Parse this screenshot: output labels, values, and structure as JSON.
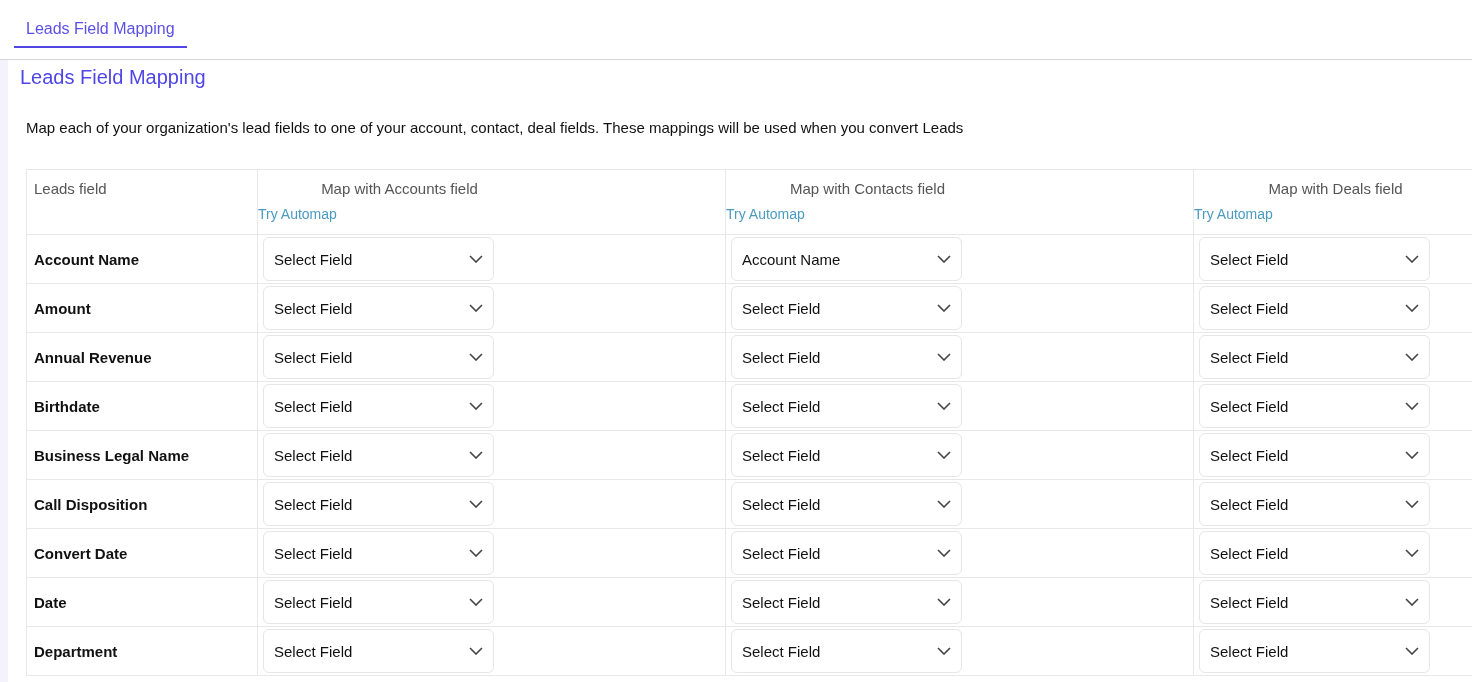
{
  "tabs": [
    {
      "label": "Leads Field Mapping",
      "selected": true
    }
  ],
  "page": {
    "title": "Leads Field Mapping",
    "description": "Map each of your organization's lead fields to one of your account, contact, deal fields. These mappings will be used when you convert Leads"
  },
  "table": {
    "columns": [
      {
        "label": "Leads field"
      },
      {
        "label": "Map with Accounts field",
        "action": "Try Automap"
      },
      {
        "label": "Map with Contacts field",
        "action": "Try Automap"
      },
      {
        "label": "Map with Deals field",
        "action": "Try Automap"
      }
    ],
    "rows": [
      {
        "field": "Account Name",
        "mappings": [
          "Select Field",
          "Account Name",
          "Select Field"
        ]
      },
      {
        "field": "Amount",
        "mappings": [
          "Select Field",
          "Select Field",
          "Select Field"
        ]
      },
      {
        "field": "Annual Revenue",
        "mappings": [
          "Select Field",
          "Select Field",
          "Select Field"
        ]
      },
      {
        "field": "Birthdate",
        "mappings": [
          "Select Field",
          "Select Field",
          "Select Field"
        ]
      },
      {
        "field": "Business Legal Name",
        "mappings": [
          "Select Field",
          "Select Field",
          "Select Field"
        ]
      },
      {
        "field": "Call Disposition",
        "mappings": [
          "Select Field",
          "Select Field",
          "Select Field"
        ]
      },
      {
        "field": "Convert Date",
        "mappings": [
          "Select Field",
          "Select Field",
          "Select Field"
        ]
      },
      {
        "field": "Date",
        "mappings": [
          "Select Field",
          "Select Field",
          "Select Field"
        ]
      },
      {
        "field": "Department",
        "mappings": [
          "Select Field",
          "Select Field",
          "Select Field"
        ]
      }
    ]
  }
}
